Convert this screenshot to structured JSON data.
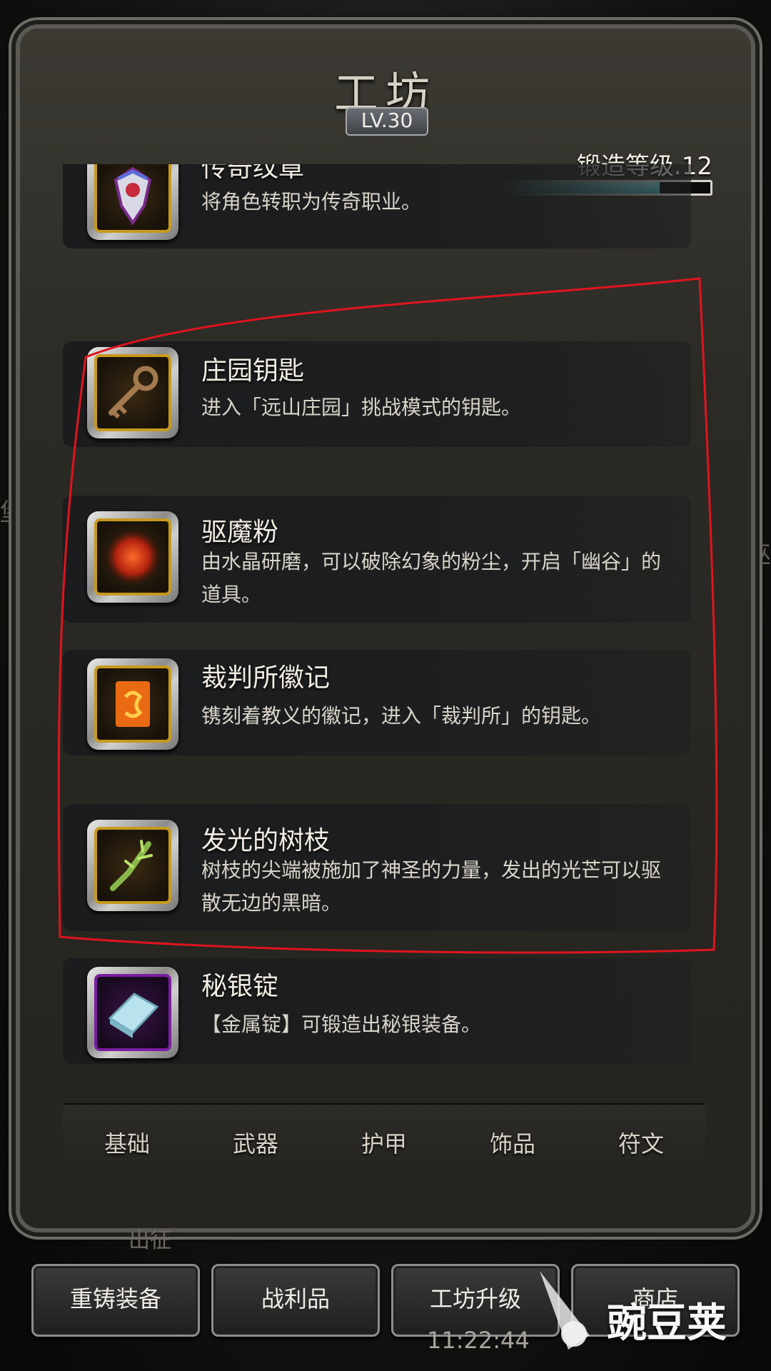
{
  "side_left_text": "堡",
  "side_right_text": "巫",
  "panel": {
    "title": "工坊",
    "level": "LV.30",
    "forge_level_label": "锻造等级.12",
    "forge_progress": 0.75
  },
  "items": [
    {
      "name": "传奇纹章",
      "desc": "将角色转职为传奇职业。",
      "icon": "legendary-emblem-icon",
      "rarity_color": "#c79a1e"
    },
    {
      "name": "庄园钥匙",
      "desc": "进入「远山庄园」挑战模式的钥匙。",
      "icon": "manor-key-icon",
      "rarity_color": "#c79a1e"
    },
    {
      "name": "驱魔粉",
      "desc": "由水晶研磨，可以破除幻象的粉尘，开启「幽谷」的道具。",
      "icon": "exorcism-powder-icon",
      "rarity_color": "#c79a1e"
    },
    {
      "name": "裁判所徽记",
      "desc": "镌刻着教义的徽记，进入「裁判所」的钥匙。",
      "icon": "inquisition-badge-icon",
      "rarity_color": "#c79a1e"
    },
    {
      "name": "发光的树枝",
      "desc": "树枝的尖端被施加了神圣的力量，发出的光芒可以驱散无边的黑暗。",
      "icon": "glowing-branch-icon",
      "rarity_color": "#c79a1e"
    },
    {
      "name": "秘银锭",
      "desc": "【金属锭】可锻造出秘银装备。",
      "icon": "mithril-ingot-icon",
      "rarity_color": "#7a1ea0"
    }
  ],
  "tabs": [
    "基础",
    "武器",
    "护甲",
    "饰品",
    "符文"
  ],
  "expedition_label": "出征",
  "bottom_buttons": [
    "重铸装备",
    "战利品",
    "工坊升级",
    "商店"
  ],
  "status_time": "11:22:44",
  "watermark": "豌豆荚",
  "annotation_color": "#e0141e"
}
